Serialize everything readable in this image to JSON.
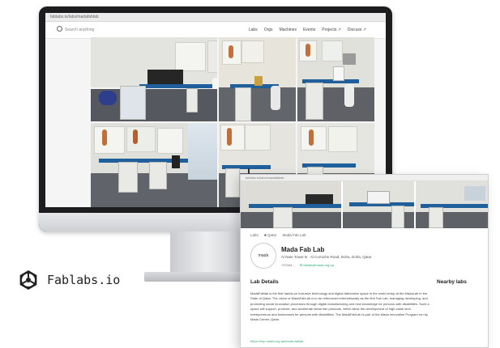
{
  "monitor": {
    "url": "fablabs.io/labs/madafablab",
    "search_placeholder": "Search anything",
    "nav": [
      "Labs",
      "Orgs",
      "Machines",
      "Events",
      "Projects ↗",
      "Discuss ↗"
    ]
  },
  "card": {
    "url": "fablabs.io/labs/madafablab",
    "breadcrumb": [
      "Labs",
      "■ Qatar",
      "Mada Fab Lab"
    ],
    "logo_text": "mada",
    "title": "Mada Fab Lab",
    "address": "Al Nasr Tower B · Al Corniche Road, Doha, Doha, Qatar",
    "phone": "+97444...",
    "email": "✉ fablab@mada.org.qa",
    "section_details": "Lab Details",
    "section_nearby": "Nearby labs",
    "description": "MadaFablab is the first hands-on inclusive technology and digital fabrication space in the world setup at the MadaLab in the State of Qatar. The vision of MadaFabLab is to be referenced internationally as the first Fab Lab, managing developing, and promoting social innovation processes through digital manufacturing and new knowledge for persons with disabilities. Such a space will support, promote, and accelerate ideas into products, which allow the development of high-value tech entrepreneurs and businesses for persons with disabilities. The MadaFabLab is part of the Mada Innovation Program run by Mada Center, Qatar.",
    "link": "https://mip.mada.org.qa/mada-fablab"
  },
  "brand": {
    "name": "Fablabs.io",
    "icon": "fablabs-logo-icon"
  },
  "colors": {
    "desk_blue": "#1f5f9c",
    "link_green": "#33aa77"
  }
}
